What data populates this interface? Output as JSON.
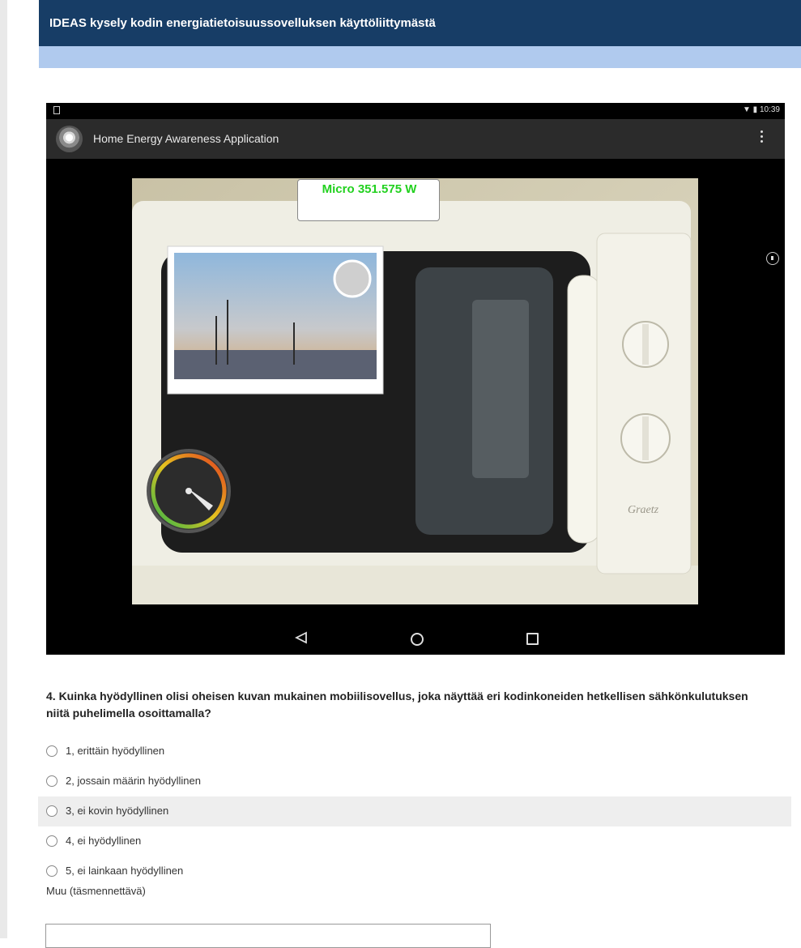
{
  "survey": {
    "title": "IDEAS kysely kodin energiatietoisuussovelluksen käyttöliittymästä"
  },
  "phone": {
    "status_time": "10:39",
    "app_name": "Home Energy Awareness Application",
    "power_readout": "Micro  351.575 W",
    "icons": [
      "app-logo-icon",
      "overflow-menu-icon",
      "back-icon",
      "home-icon",
      "recent-apps-icon",
      "gauge-icon"
    ]
  },
  "question": {
    "text": "4. Kuinka hyödyllinen olisi oheisen kuvan mukainen mobiilisovellus, joka näyttää eri kodinkoneiden hetkellisen sähkönkulutuksen niitä puhelimella osoittamalla?",
    "options": [
      {
        "label": "1, erittäin hyödyllinen"
      },
      {
        "label": "2, jossain määrin hyödyllinen"
      },
      {
        "label": "3, ei kovin hyödyllinen"
      },
      {
        "label": "4, ei hyödyllinen"
      },
      {
        "label": "5, ei lainkaan hyödyllinen"
      }
    ],
    "other_label": "Muu (täsmennettävä)",
    "other_value": ""
  },
  "colors": {
    "header": "#173d66",
    "subheader": "#b0caee",
    "readout_text": "#22d11f",
    "highlight_row": "#eeeeee"
  }
}
